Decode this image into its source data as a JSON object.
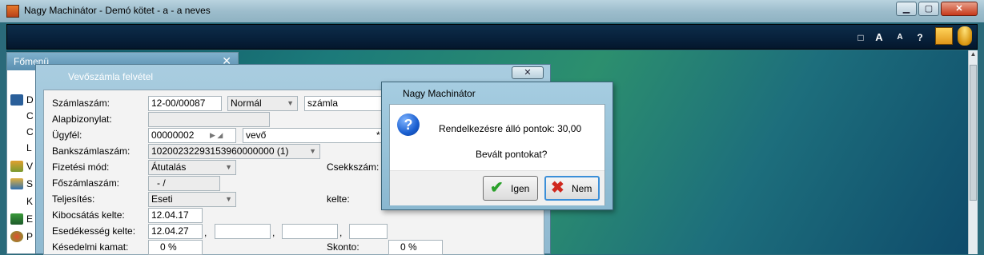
{
  "window": {
    "title": "Nagy Machinátor - Demó kötet - a - a neves",
    "min": "▁",
    "max": "▢",
    "close": "✕"
  },
  "toolbar": {
    "btn_window": "□",
    "btn_font_large": "A",
    "btn_font_small": "A",
    "btn_help": "?"
  },
  "fomenu": {
    "title": "Főmenü",
    "close": "✕",
    "items": [
      {
        "letter": "D"
      },
      {
        "letter": "C"
      },
      {
        "letter": "C"
      },
      {
        "letter": "L"
      },
      {
        "letter": "V"
      },
      {
        "letter": "S"
      },
      {
        "letter": "K"
      },
      {
        "letter": "E"
      },
      {
        "letter": "P"
      }
    ]
  },
  "vevo": {
    "title": "Vevőszámla felvétel",
    "close": "✕",
    "labels": {
      "szamlaszam": "Számlaszám:",
      "alapbizonylat": "Alapbizonylat:",
      "ugyfel": "Ügyfél:",
      "bankszamlaszam": "Bankszámlaszám:",
      "fizetesi_mod": "Fizetési mód:",
      "foszamlaszam": "Főszámlaszám:",
      "teljesites": "Teljesítés:",
      "kibocsatas": "Kibocsátás kelte:",
      "esedekesseg": "Esedékesség kelte:",
      "kesedelmi": "Késedelmi kamat:",
      "csekkszam": "Csekkszám:",
      "kelte": "kelte:",
      "skonto": "Skonto:"
    },
    "values": {
      "szamlaszam": "12-00/00087",
      "szamla_type": "Normál",
      "szamla_kind": "számla",
      "alapbizonylat": "",
      "ugyfel_code": "00000002",
      "ugyfel_name": "vevő",
      "ugyfel_star": "*",
      "bankszamlaszam": "10200232293153960000000 (1)",
      "fizetesi_mod": "Átutalás",
      "foszamlaszam": "- /",
      "teljesites": "Eseti",
      "kibocsatas": "12.04.17",
      "esedekesseg": "12.04.27",
      "kesedelmi": "0 %",
      "skonto": "0 %",
      "comma": ","
    }
  },
  "msgbox": {
    "title": "Nagy Machinátor",
    "line1": "Rendelkezésre álló pontok: 30,00",
    "line2": "Bevált pontokat?",
    "yes": "Igen",
    "no": "Nem",
    "yes_glyph": "✔",
    "no_glyph": "✖"
  }
}
